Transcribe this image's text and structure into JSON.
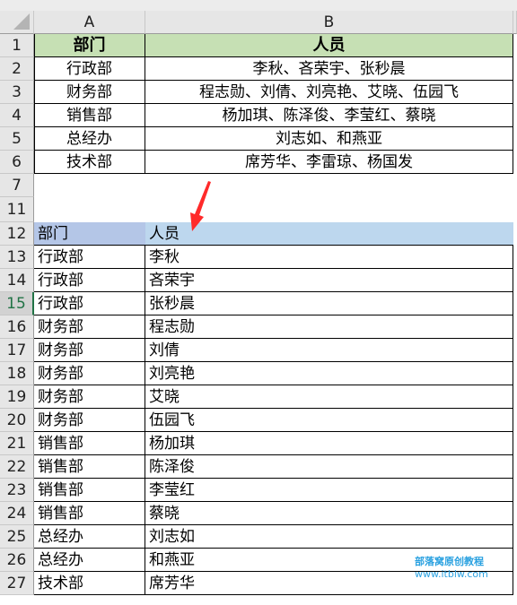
{
  "columns": [
    {
      "id": "A",
      "label": "A"
    },
    {
      "id": "B",
      "label": "B"
    }
  ],
  "top_table": {
    "header": {
      "row": "1",
      "dept": "部门",
      "people": "人员"
    },
    "rows": [
      {
        "row": "2",
        "dept": "行政部",
        "people": "李秋、吝荣宇、张秒晨"
      },
      {
        "row": "3",
        "dept": "财务部",
        "people": "程志勋、刘倩、刘亮艳、艾晓、伍园飞"
      },
      {
        "row": "4",
        "dept": "销售部",
        "people": "杨加琪、陈泽俊、李莹红、蔡晓"
      },
      {
        "row": "5",
        "dept": "总经办",
        "people": "刘志如、和燕亚"
      },
      {
        "row": "6",
        "dept": "技术部",
        "people": "席芳华、李雷琼、杨国发"
      }
    ]
  },
  "gap_rows": [
    "7",
    "11"
  ],
  "bottom_table": {
    "header": {
      "row": "12",
      "dept": "部门",
      "people": "人员"
    },
    "rows": [
      {
        "row": "13",
        "dept": "行政部",
        "people": "李秋"
      },
      {
        "row": "14",
        "dept": "行政部",
        "people": "吝荣宇"
      },
      {
        "row": "15",
        "dept": "行政部",
        "people": "张秒晨"
      },
      {
        "row": "16",
        "dept": "财务部",
        "people": "程志勋"
      },
      {
        "row": "17",
        "dept": "财务部",
        "people": "刘倩"
      },
      {
        "row": "18",
        "dept": "财务部",
        "people": "刘亮艳"
      },
      {
        "row": "19",
        "dept": "财务部",
        "people": "艾晓"
      },
      {
        "row": "20",
        "dept": "财务部",
        "people": "伍园飞"
      },
      {
        "row": "21",
        "dept": "销售部",
        "people": "杨加琪"
      },
      {
        "row": "22",
        "dept": "销售部",
        "people": "陈泽俊"
      },
      {
        "row": "23",
        "dept": "销售部",
        "people": "李莹红"
      },
      {
        "row": "24",
        "dept": "销售部",
        "people": "蔡晓"
      },
      {
        "row": "25",
        "dept": "总经办",
        "people": "刘志如"
      },
      {
        "row": "26",
        "dept": "总经办",
        "people": "和燕亚"
      },
      {
        "row": "27",
        "dept": "技术部",
        "people": "席芳华"
      }
    ]
  },
  "active_row": "15",
  "colors": {
    "header_green": "#c6e0b4",
    "header_blue_a": "#b4c6e7",
    "header_blue_b": "#bdd7ee",
    "arrow_red": "#ff2a2a",
    "active_row_green": "#217346",
    "watermark_blue": "#2aa1e0"
  },
  "watermark": {
    "title": "部落窝原创教程",
    "url": "www.itblw.com"
  }
}
